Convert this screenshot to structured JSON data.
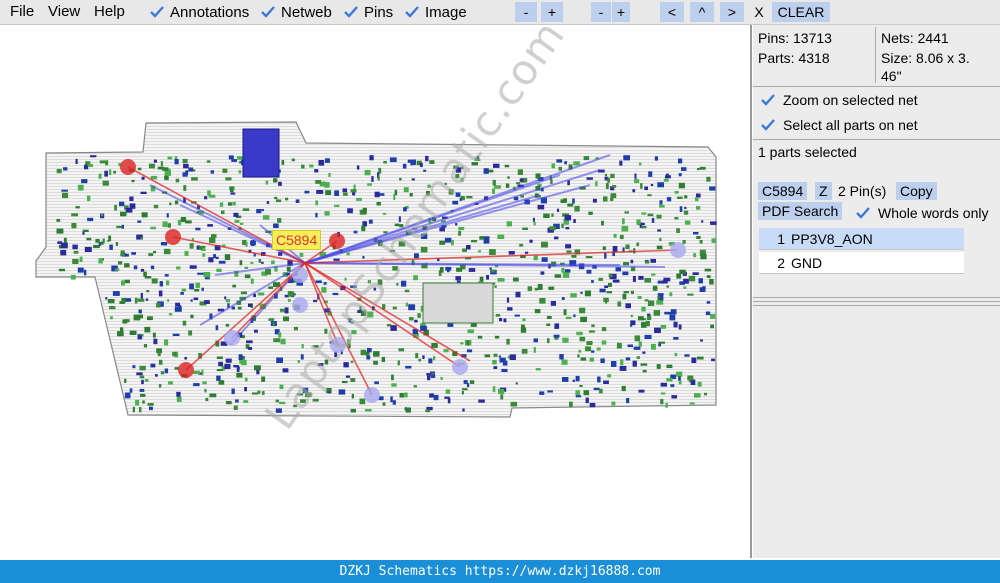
{
  "menu": {
    "file": "File",
    "view": "View",
    "help": "Help"
  },
  "toolbar": {
    "annotations": "Annotations",
    "netweb": "Netweb",
    "pins": "Pins",
    "image": "Image",
    "zoom_out": "-",
    "zoom_in": "+",
    "zoom_out2": "-",
    "zoom_in2": "+",
    "nav_left": "<",
    "nav_up": "^",
    "nav_right": ">",
    "close_x": "X",
    "clear": "CLEAR"
  },
  "canvas": {
    "part_label": "C5894",
    "watermark": "LaptopSchematic.com"
  },
  "panel": {
    "pins": "Pins: 13713",
    "parts": "Parts: 4318",
    "nets": "Nets: 2441",
    "size_line1": "Size: 8.06 x 3.",
    "size_line2": "46\"",
    "zoom_selected": "Zoom on selected net",
    "select_all": "Select all parts on net",
    "selected_count": "1 parts selected",
    "part_name": "C5894",
    "z_button": "Z",
    "pin_count": "2 Pin(s)",
    "copy_button": "Copy",
    "pdf_search": "PDF Search",
    "whole_words": "Whole words only",
    "nets_list": [
      {
        "num": "1",
        "name": "PP3V8_AON"
      },
      {
        "num": "2",
        "name": "GND"
      }
    ]
  },
  "status_bar": "DZKJ Schematics https://www.dzkj16888.com",
  "colors": {
    "accent": "#1a8ed6",
    "button": "#bcd0ee",
    "highlight": "#c8dcf8",
    "check": "#3a7bd5"
  }
}
